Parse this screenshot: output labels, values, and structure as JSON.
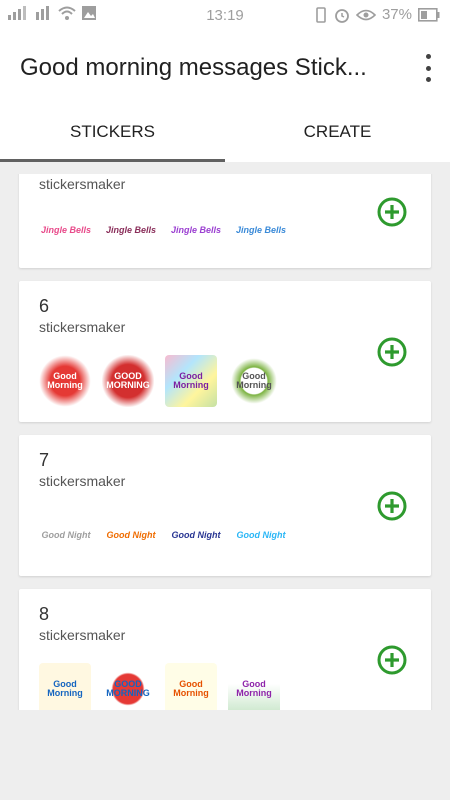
{
  "status_bar": {
    "time": "13:19",
    "battery": "37%"
  },
  "app_bar": {
    "title": "Good morning messages Stick..."
  },
  "tabs": [
    {
      "label": "STICKERS"
    },
    {
      "label": "CREATE"
    }
  ],
  "packs": [
    {
      "number": "",
      "publisher": "stickersmaker",
      "stickers": [
        "Jingle Bells",
        "Jingle Bells",
        "Jingle Bells",
        "Jingle Bells"
      ]
    },
    {
      "number": "6",
      "publisher": "stickersmaker",
      "stickers": [
        "Good Morning",
        "GOOD MORNING",
        "Good Morning",
        "Good Morning"
      ]
    },
    {
      "number": "7",
      "publisher": "stickersmaker",
      "stickers": [
        "Good Night",
        "Good Night",
        "Good Night",
        "Good Night"
      ]
    },
    {
      "number": "8",
      "publisher": "stickersmaker",
      "stickers": [
        "Good Morning",
        "GOOD MORNING",
        "Good Morning",
        "Good Morning"
      ]
    }
  ],
  "colors": {
    "accent_green": "#2e9a2e",
    "tab_indicator": "#616161"
  }
}
